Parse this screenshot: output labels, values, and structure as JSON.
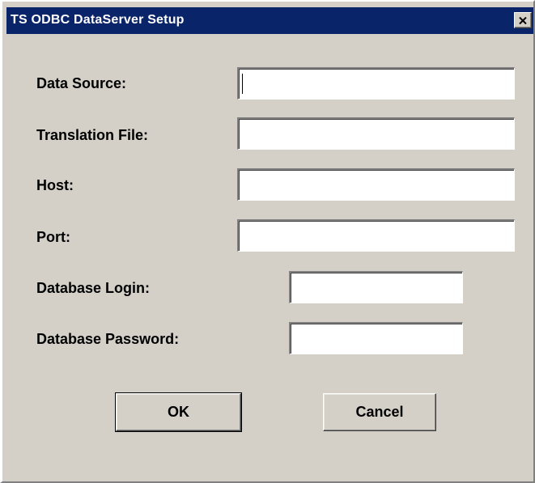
{
  "window": {
    "title": "TS ODBC DataServer Setup",
    "close_icon": "close-icon"
  },
  "form": {
    "data_source": {
      "label": "Data Source:",
      "value": ""
    },
    "translation_file": {
      "label": "Translation File:",
      "value": ""
    },
    "host": {
      "label": "Host:",
      "value": ""
    },
    "port": {
      "label": "Port:",
      "value": ""
    },
    "database_login": {
      "label": "Database Login:",
      "value": ""
    },
    "database_password": {
      "label": "Database Password:",
      "value": ""
    }
  },
  "buttons": {
    "ok_label": "OK",
    "cancel_label": "Cancel"
  },
  "colors": {
    "titlebar": "#0a246a",
    "dialog_face": "#d4d0c8"
  }
}
